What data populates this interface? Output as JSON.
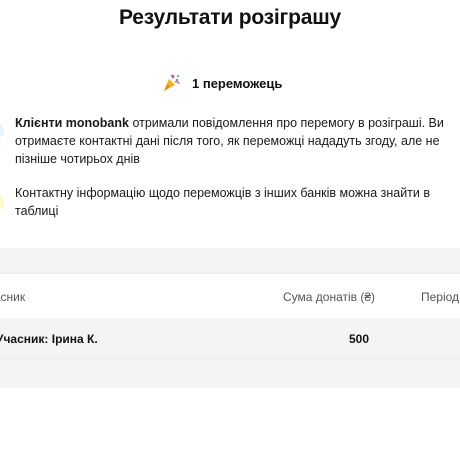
{
  "page": {
    "title": "Результати розіграшу"
  },
  "winners": {
    "icon": "party-popper-icon",
    "count_label": "1 переможець"
  },
  "notes": [
    {
      "bold": "Клієнти monobank",
      "text": " отримали повідомлення про перемогу в розіграші. Ви отримаєте контактні дані після того, як переможці нададуть згоду, але не пізніше чотирьох днів"
    },
    {
      "text": "Контактну інформацію щодо переможців з інших банків можна знайти в таблиці"
    }
  ],
  "table": {
    "columns": [
      "Учасник",
      "Сума донатів (₴)",
      "Період"
    ],
    "rows": [
      {
        "name": "Учасник: Ірина К.",
        "amount": "500",
        "period": ""
      }
    ]
  },
  "colors": {
    "band_background": "#f4f4f4",
    "note_dot_blue": "#e8f4ff",
    "note_dot_yellow": "#fff6c8"
  }
}
